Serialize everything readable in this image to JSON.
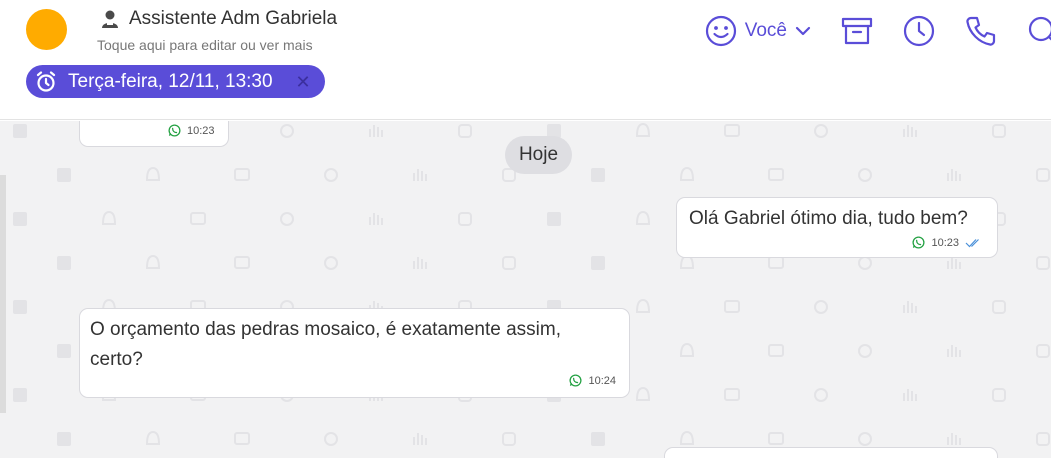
{
  "header": {
    "contact_name": "Assistente Adm Gabriela",
    "contact_subtitle": "Toque aqui para editar ou ver mais",
    "avatar_color": "#ffab00",
    "agent_label": "Você",
    "icons": [
      "smiley-icon",
      "chevron-down-icon",
      "archive-icon",
      "clock-icon",
      "phone-icon",
      "search-icon"
    ],
    "accent_color": "#5a4dd8"
  },
  "schedule": {
    "label": "Terça-feira, 12/11, 13:30",
    "close": "✕"
  },
  "chat": {
    "day_separator": "Hoje",
    "messages": [
      {
        "direction": "in",
        "text": "",
        "time": "10:23"
      },
      {
        "direction": "out",
        "text": "Olá Gabriel ótimo dia, tudo bem?",
        "time": "10:23",
        "status": "read"
      },
      {
        "direction": "in",
        "text": "O orçamento das pedras mosaico, é exatamente assim, certo?",
        "time": "10:24"
      }
    ]
  }
}
